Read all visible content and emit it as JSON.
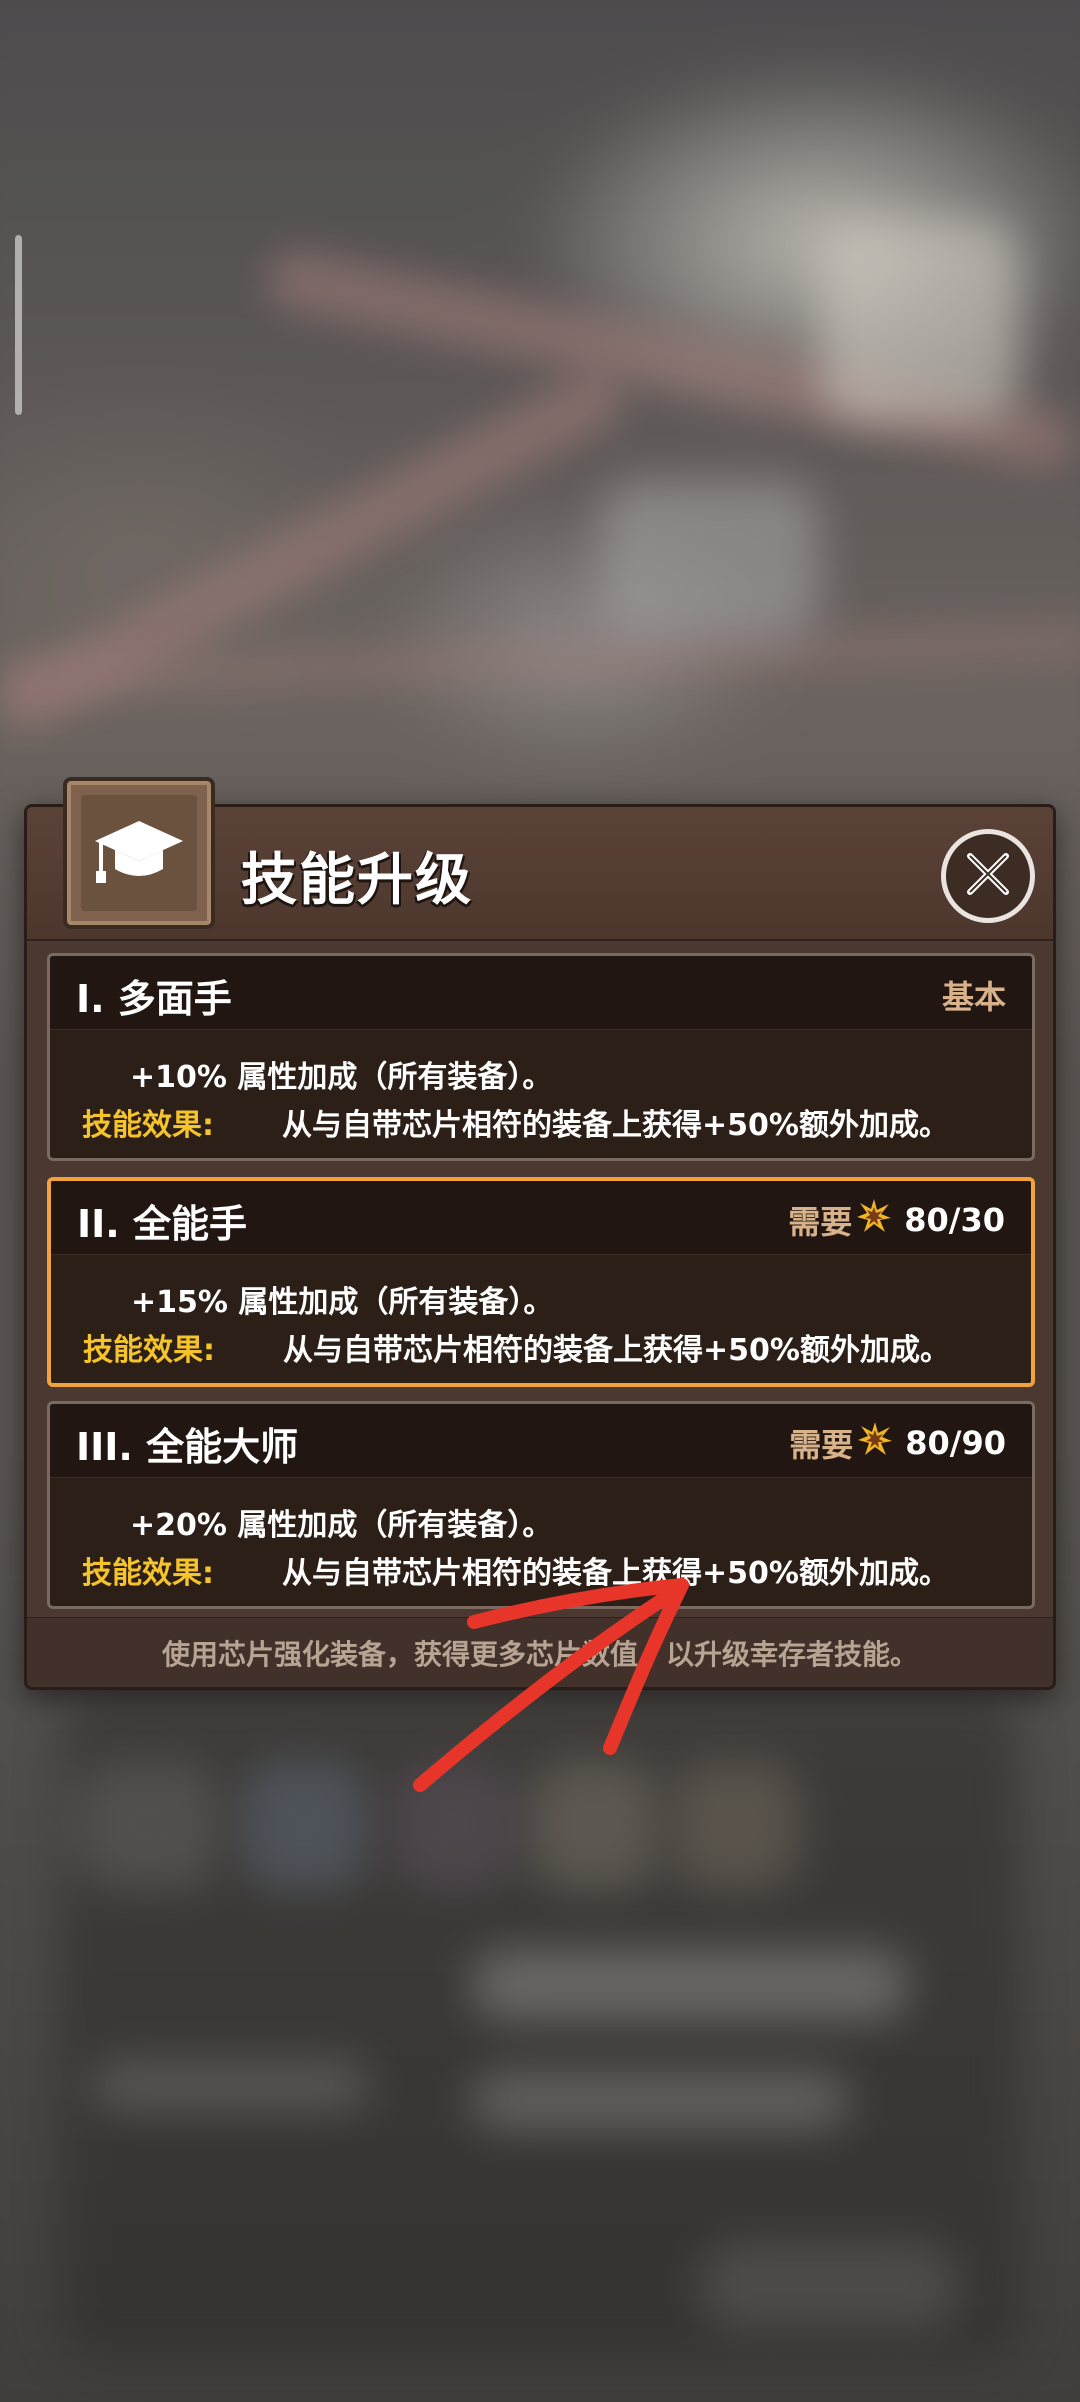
{
  "dialog": {
    "title": "技能升级",
    "icon": "graduation-cap-icon",
    "close_icon": "close-icon",
    "footer": "使用芯片强化装备，获得更多芯片数值，以升级幸存者技能。"
  },
  "skills": [
    {
      "name": "I. 多面手",
      "status": "基本",
      "requirement_label": "",
      "requirement_value": "",
      "line1": "+10% 属性加成（所有装备）。",
      "effect_label": "技能效果:",
      "effect_text": "从与自带芯片相符的装备上获得+50%额外加成。",
      "highlighted": false
    },
    {
      "name": "II. 全能手",
      "status": "",
      "requirement_label": "需要",
      "requirement_value": "80/30",
      "line1": "+15% 属性加成（所有装备）。",
      "effect_label": "技能效果:",
      "effect_text": "从与自带芯片相符的装备上获得+50%额外加成。",
      "highlighted": true
    },
    {
      "name": "III. 全能大师",
      "status": "",
      "requirement_label": "需要",
      "requirement_value": "80/90",
      "line1": "+20% 属性加成（所有装备）。",
      "effect_label": "技能效果:",
      "effect_text": "从与自带芯片相符的装备上获得+50%额外加成。",
      "highlighted": false
    }
  ],
  "colors": {
    "accent_border": "#f2a23a",
    "effect_label": "#f5c32a",
    "requirement_text": "#d7b28a",
    "annotation_red": "#e8352a"
  }
}
